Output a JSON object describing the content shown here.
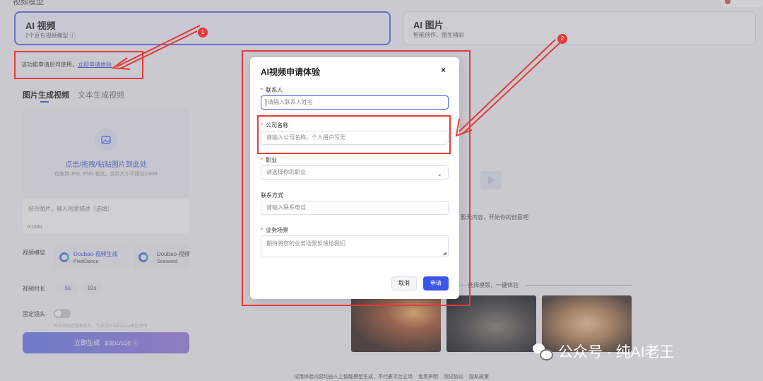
{
  "header": {
    "page_label": "视频模型"
  },
  "mode_cards": [
    {
      "title": "AI 视频",
      "subtitle": "2个豆包视频模型 ⓘ"
    },
    {
      "title": "AI 图片",
      "subtitle": "智能创作、图生精彩"
    }
  ],
  "notice": {
    "text": "该功能申请后可使用，",
    "link": "立即申请体验"
  },
  "sub_tabs": [
    "图片生成视频",
    "文本生成视频"
  ],
  "upload": {
    "icon": "image-icon",
    "title": "点击/拖拽/粘贴图片到此处",
    "hint": "仅支持 JPG, PNG 格式，文件大小不超过10MB"
  },
  "description": {
    "placeholder": "结合图片，输入创意描述（选填）",
    "count": "0/1000"
  },
  "model_row": {
    "label": "视频模型",
    "models": [
      {
        "name": "Doubao-视频生成",
        "sub": "PixelDance"
      },
      {
        "name": "Doubao-视频",
        "sub": "Seaweed"
      }
    ]
  },
  "duration_row": {
    "label": "视频时长",
    "options": [
      "5s",
      "10s"
    ]
  },
  "lens_row": {
    "label": "固定镜头",
    "hint": "开启后固定摄像机位，仅支持PixelDance模型使用"
  },
  "generate": {
    "label": "立即生成",
    "quota": "本周10/10次 ⓘ"
  },
  "right": {
    "empty_text": "暂无内容，开始你的创意吧",
    "template_text": "选择模版，一键体验"
  },
  "footer": [
    "试用体验内容均由人工智能模型生成，不代表平台立场",
    "免责声明",
    "测试协议",
    "隐私政策"
  ],
  "watermark": "公众号 · 纯AI老王",
  "modal": {
    "title": "AI视频申请体验",
    "close": "×",
    "fields": {
      "contact": {
        "label": "联系人",
        "placeholder": "请输入联系人姓名"
      },
      "company": {
        "label": "公司名称",
        "placeholder": "请输入公司名称，个人用户写无"
      },
      "job": {
        "label": "职业",
        "placeholder": "请选择你的职业"
      },
      "phone": {
        "label": "联系方式",
        "placeholder": "请输入联系电话"
      },
      "scenario": {
        "label": "业务场景",
        "placeholder": "期待将您的业务场景反馈给我们"
      }
    },
    "cancel": "取消",
    "submit": "申请"
  },
  "annotations": {
    "badge_1": "1",
    "badge_2": "2"
  },
  "colors": {
    "accent": "#3a56e8",
    "annotation": "#e33b3b",
    "required": "#e54545"
  }
}
